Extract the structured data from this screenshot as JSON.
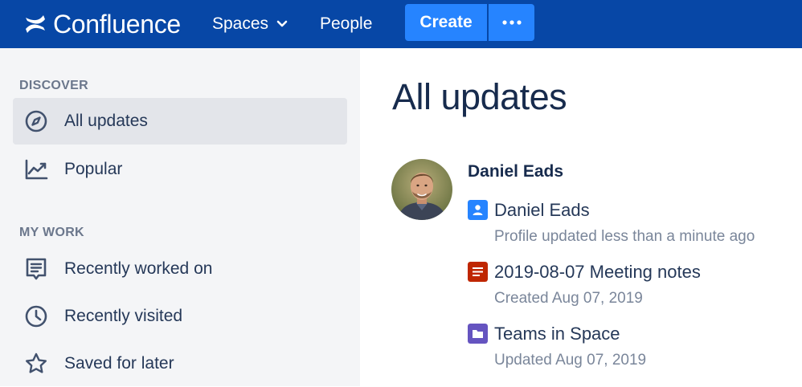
{
  "topnav": {
    "logo_text": "Confluence",
    "spaces_label": "Spaces",
    "people_label": "People",
    "create_label": "Create"
  },
  "sidebar": {
    "discover_heading": "DISCOVER",
    "discover_items": [
      {
        "label": "All updates",
        "icon": "compass-icon",
        "active": true
      },
      {
        "label": "Popular",
        "icon": "trending-chart-icon",
        "active": false
      }
    ],
    "my_work_heading": "MY WORK",
    "my_work_items": [
      {
        "label": "Recently worked on",
        "icon": "document-icon"
      },
      {
        "label": "Recently visited",
        "icon": "clock-icon"
      },
      {
        "label": "Saved for later",
        "icon": "star-icon"
      }
    ]
  },
  "main": {
    "title": "All updates",
    "author": "Daniel Eads",
    "updates": [
      {
        "title": "Daniel Eads",
        "meta": "Profile updated less than a minute ago",
        "icon": "profile-icon",
        "color": "#2684ff"
      },
      {
        "title": "2019-08-07 Meeting notes",
        "meta": "Created Aug 07, 2019",
        "icon": "meeting-notes-icon",
        "color": "#bf2600"
      },
      {
        "title": "Teams in Space",
        "meta": "Updated Aug 07, 2019",
        "icon": "folder-icon",
        "color": "#6554c0"
      }
    ]
  },
  "colors": {
    "nav_background": "#0747a6",
    "create_button": "#2684ff",
    "sidebar_background": "#f4f5f7",
    "sidebar_active": "#e3e5ea"
  }
}
